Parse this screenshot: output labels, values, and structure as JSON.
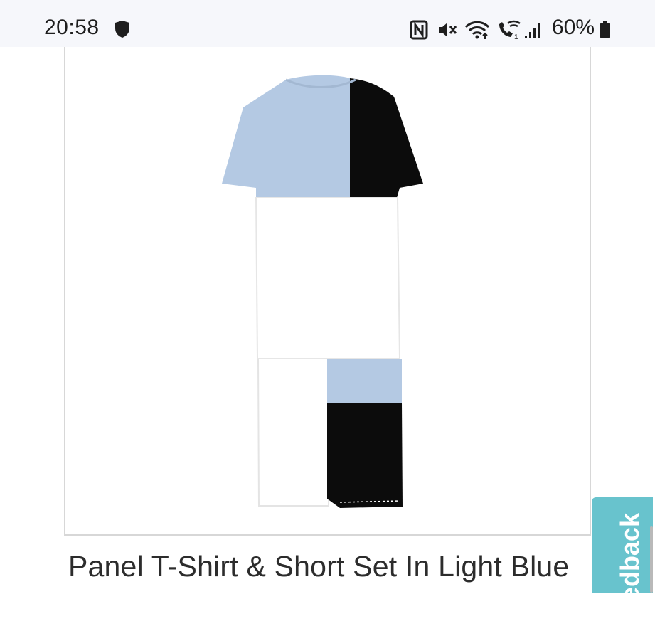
{
  "status_bar": {
    "time": "20:58",
    "battery_percent": "60%",
    "icons": [
      "shield-icon",
      "nfc-icon",
      "mute-icon",
      "wifi-icon",
      "wifi-calling-icon",
      "signal-icon",
      "battery-icon"
    ]
  },
  "product": {
    "title": "Panel T-Shirt & Short Set In Light Blue",
    "image": "panel-tshirt-short-set-image",
    "colors": {
      "light_blue": "#b4c9e3",
      "black": "#0c0c0c",
      "white": "#ffffff"
    }
  },
  "feedback": {
    "label": "Feedback",
    "color": "#68c3cd"
  }
}
